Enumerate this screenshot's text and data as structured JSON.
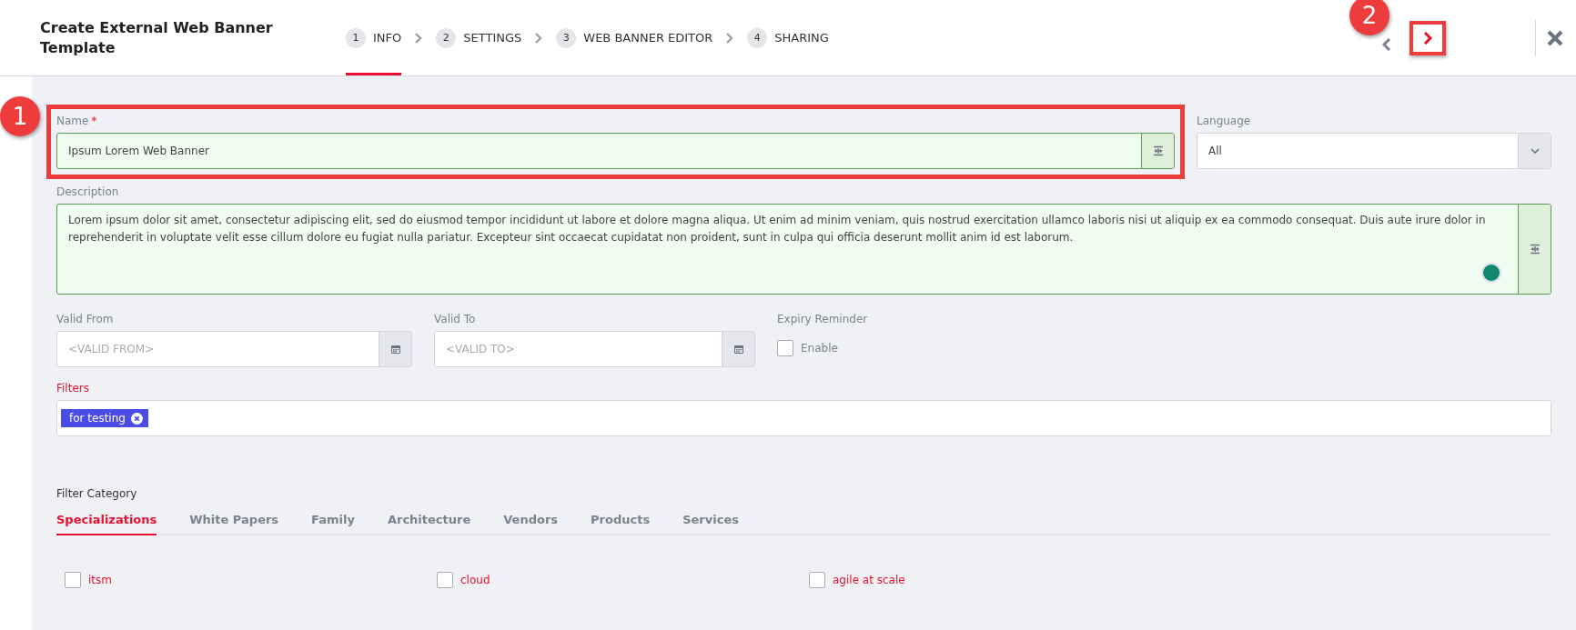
{
  "header": {
    "title": "Create External Web Banner Template",
    "steps": [
      {
        "number": "1",
        "label": "INFO",
        "selected": true
      },
      {
        "number": "2",
        "label": "SETTINGS",
        "selected": false
      },
      {
        "number": "3",
        "label": "WEB BANNER EDITOR",
        "selected": false
      },
      {
        "number": "4",
        "label": "SHARING",
        "selected": false
      }
    ],
    "next_highlighted": true,
    "next_callout": "2"
  },
  "name": {
    "label": "Name",
    "required": "*",
    "value": "Ipsum Lorem Web Banner",
    "highlighted": true,
    "callout": "1"
  },
  "language": {
    "label": "Language",
    "value": "All"
  },
  "description": {
    "label": "Description",
    "value": "Lorem ipsum dolor sit amet, consectetur adipiscing elit, sed do eiusmod tempor incididunt ut labore et dolore magna aliqua. Ut enim ad minim veniam, quis nostrud exercitation ullamco laboris nisi ut aliquip ex ea commodo consequat. Duis aute irure dolor in reprehenderit in voluptate velit esse cillum dolore eu fugiat nulla pariatur. Excepteur sint occaecat cupidatat non proident, sunt in culpa qui officia deserunt mollit anim id est laborum."
  },
  "valid_from": {
    "label": "Valid From",
    "placeholder": "<VALID FROM>"
  },
  "valid_to": {
    "label": "Valid To",
    "placeholder": "<VALID TO>"
  },
  "expiry_reminder": {
    "label": "Expiry Reminder",
    "option": "Enable",
    "checked": false
  },
  "filters": {
    "label": "Filters",
    "tags": [
      "for testing"
    ]
  },
  "filter_category": {
    "label": "Filter Category",
    "tabs": [
      {
        "label": "Specializations",
        "selected": true
      },
      {
        "label": "White Papers",
        "selected": false
      },
      {
        "label": "Family",
        "selected": false
      },
      {
        "label": "Architecture",
        "selected": false
      },
      {
        "label": "Vendors",
        "selected": false
      },
      {
        "label": "Products",
        "selected": false
      },
      {
        "label": "Services",
        "selected": false
      }
    ],
    "options": [
      {
        "label": "itsm",
        "checked": false
      },
      {
        "label": "cloud",
        "checked": false
      },
      {
        "label": "agile at scale",
        "checked": false
      }
    ]
  }
}
